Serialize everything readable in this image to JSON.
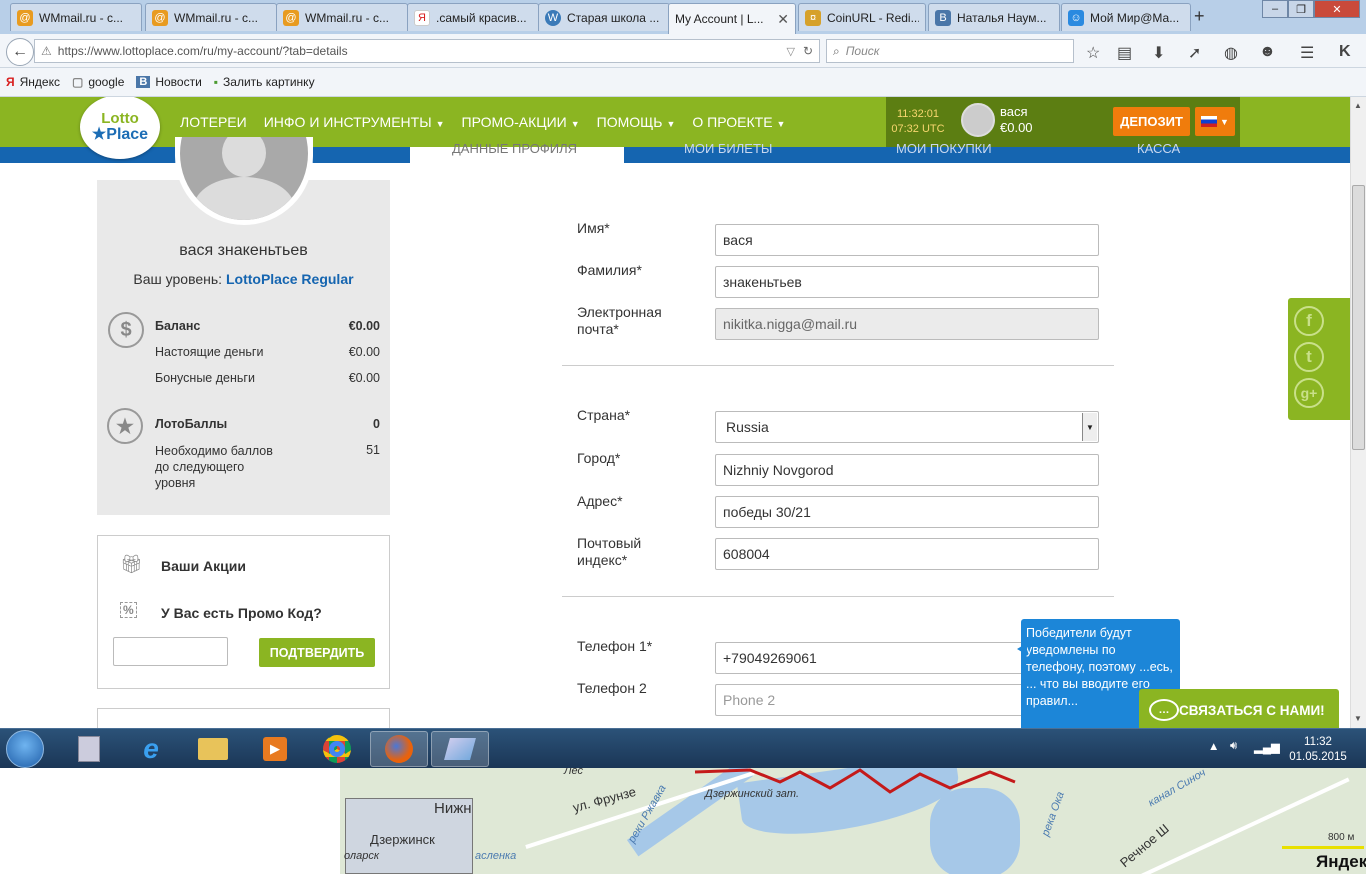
{
  "browser": {
    "tabs": [
      {
        "label": "WMmail.ru - с...",
        "icon": "wmmail-icon",
        "color": "#e89b20"
      },
      {
        "label": "WMmail.ru - с...",
        "icon": "wmmail-icon",
        "color": "#e89b20"
      },
      {
        "label": "WMmail.ru - с...",
        "icon": "wmmail-icon",
        "color": "#e89b20"
      },
      {
        "label": ".самый красив...",
        "icon": "yandex-icon",
        "color": "#d82020"
      },
      {
        "label": "Старая школа ...",
        "icon": "wordpress-icon",
        "color": "#3a7ab8"
      },
      {
        "label": "My Account | L...",
        "icon": "",
        "color": ""
      },
      {
        "label": "CoinURL - Redi...",
        "icon": "coinurl-icon",
        "color": "#d6a12a"
      },
      {
        "label": "Наталья Наум...",
        "icon": "vk-icon",
        "color": "#4a76a8"
      },
      {
        "label": "Мой Мир@Ма...",
        "icon": "mymir-icon",
        "color": "#2a8ae0"
      }
    ],
    "new_tab": "+",
    "url": "https://www.lottoplace.com/ru/my-account/?tab=details",
    "search_placeholder": "Поиск",
    "bookmarks": [
      {
        "label": "Яндекс",
        "icon": "Я"
      },
      {
        "label": "google",
        "icon": "▢"
      },
      {
        "label": "Новости",
        "icon": "B"
      },
      {
        "label": "Залить картинку",
        "icon": "▪"
      }
    ]
  },
  "site": {
    "logo_top": "Lotto",
    "logo_bottom": "★Place",
    "nav": [
      "ЛОТЕРЕИ",
      "ИНФО И ИНСТРУМЕНТЫ",
      "ПРОМО-АКЦИИ",
      "ПОМОЩЬ",
      "О ПРОЕКТЕ"
    ],
    "clock_time": "11:32:01",
    "clock_utc": "07:32 UTC",
    "user_name": "вася",
    "user_balance": "€0.00",
    "deposit": "ДЕПОЗИТ",
    "subtabs": [
      "ДАННЫЕ ПРОФИЛЯ",
      "МОИ БИЛЕТЫ",
      "МОИ ПОКУПКИ",
      "КАССА"
    ]
  },
  "profile": {
    "full_name": "вася знакеньтьев",
    "level_prefix": "Ваш уровень:",
    "level_name": "LottoPlace Regular",
    "balance_label": "Баланс",
    "balance_value": "€0.00",
    "real_money_label": "Настоящие деньги",
    "real_money_value": "€0.00",
    "bonus_label": "Бонусные деньги",
    "bonus_value": "€0.00",
    "points_label": "ЛотоБаллы",
    "points_value": "0",
    "points_needed_label": "Необходимо баллов до следующего уровня",
    "points_needed_value": "51"
  },
  "promo": {
    "actions_label": "Ваши Акции",
    "promo_question": "У Вас есть Промо Код?",
    "confirm": "ПОДТВЕРДИТЬ"
  },
  "form": {
    "first_name_label": "Имя*",
    "first_name": "вася",
    "last_name_label": "Фамилия*",
    "last_name": "знакеньтьев",
    "email_label": "Электронная почта*",
    "email": "nikitka.nigga@mail.ru",
    "country_label": "Страна*",
    "country": "Russia",
    "city_label": "Город*",
    "city": "Nizhniy Novgorod",
    "address_label": "Адрес*",
    "address": "победы 30/21",
    "zip_label": "Почтовый индекс*",
    "zip": "608004",
    "phone1_label": "Телефон 1*",
    "phone1": "+79049269061",
    "phone2_label": "Телефон 2",
    "phone2_placeholder": "Phone 2",
    "tooltip": "Победители будут уведомлены по телефону, поэтому ...есь, ... что вы вводите его правил..."
  },
  "contact_button": "СВЯЗАТЬСЯ С НАМИ!",
  "taskbar": {
    "time": "11:32",
    "date": "01.05.2015"
  },
  "map": {
    "labels": [
      "Лес",
      "ул. Фрунзе",
      "Нижн",
      "Дзержинск",
      "реки Ржавка",
      "Дзержинский зат.",
      "река Ока",
      "канал Синоч",
      "Речное Ш",
      "оларск",
      "асленка",
      "800 м",
      "Яндекс"
    ]
  }
}
